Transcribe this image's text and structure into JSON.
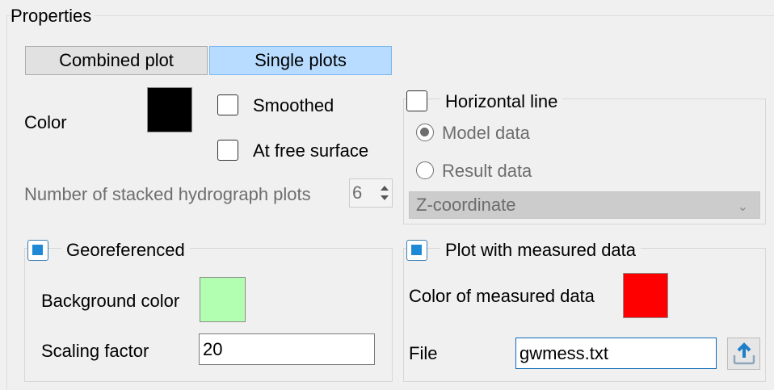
{
  "panel": {
    "title": "Properties"
  },
  "plot_mode": {
    "combined_label": "Combined plot",
    "single_label": "Single plots",
    "selected": "single"
  },
  "color": {
    "label": "Color",
    "value": "#000000"
  },
  "smoothed": {
    "label": "Smoothed",
    "checked": false
  },
  "free_surface": {
    "label": "At free surface",
    "checked": false
  },
  "stacked": {
    "label": "Number of stacked hydrograph plots",
    "value": "6"
  },
  "horizontal_line": {
    "label": "Horizontal line",
    "checked": false,
    "model_label": "Model data",
    "result_label": "Result data",
    "selected": "model",
    "coordinate": "Z-coordinate"
  },
  "georef": {
    "label": "Georeferenced",
    "checked": true,
    "bg_label": "Background color",
    "bg_color": "#b2ffb2",
    "scale_label": "Scaling factor",
    "scale_value": "20"
  },
  "measured": {
    "label": "Plot with measured data",
    "checked": true,
    "color_label": "Color of measured data",
    "color": "#ff0000",
    "file_label": "File",
    "file_value": "gwmess.txt",
    "browse_icon": "upload-icon"
  }
}
